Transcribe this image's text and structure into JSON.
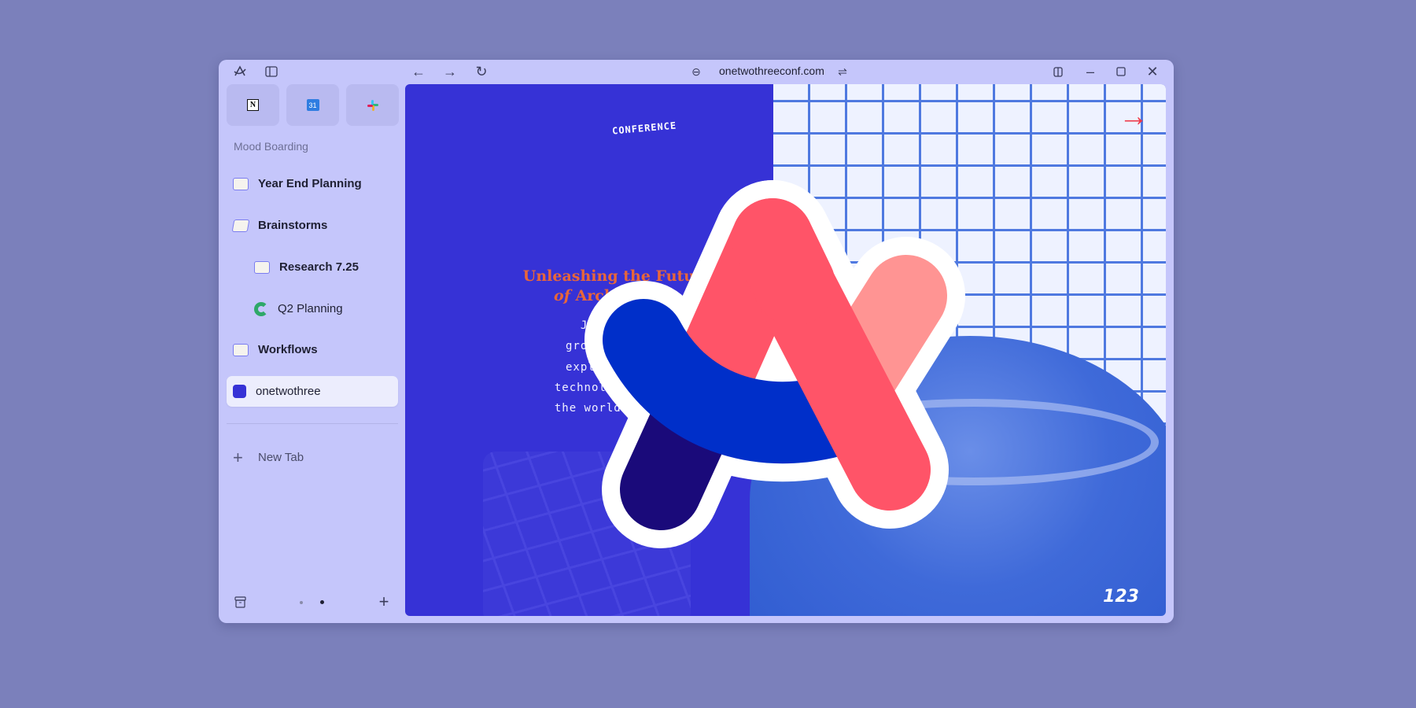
{
  "toolbar": {
    "url": "onetwothreeconf.com",
    "icons": [
      "arc-logo-icon",
      "sidebar-toggle-icon",
      "back-arrow-icon",
      "forward-arrow-icon",
      "reload-icon",
      "link-icon",
      "site-controls-icon",
      "split-view-icon",
      "minimize-icon",
      "maximize-icon",
      "close-icon"
    ]
  },
  "pinned": [
    {
      "name": "Notion",
      "glyph": "N"
    },
    {
      "name": "Google Calendar",
      "glyph": "31"
    },
    {
      "name": "Slack",
      "glyph": "#"
    }
  ],
  "sidebar": {
    "section": "Mood Boarding",
    "items": [
      {
        "label": "Year End Planning",
        "icon": "folder"
      },
      {
        "label": "Brainstorms",
        "icon": "folder-open"
      },
      {
        "label": "Research 7.25",
        "icon": "folder"
      },
      {
        "label": "Q2 Planning",
        "icon": "coda"
      },
      {
        "label": "Workflows",
        "icon": "folder"
      },
      {
        "label": "onetwothree",
        "icon": "favicon",
        "active": true
      }
    ],
    "new_tab": "New Tab"
  },
  "page": {
    "kicker": "CONFERENCE",
    "heading_line1": "Unleashing the Future",
    "heading_italic": "of",
    "heading_line2": "Architecture",
    "body": [
      "Join us in",
      "groundbreaking",
      "explores the l",
      "technologies, and",
      "the world of arch"
    ],
    "logo_mark": "123",
    "accent": "#e8663a",
    "panel_color": "#3632d6"
  },
  "colors": {
    "arc_red": "#ff5468",
    "arc_pink": "#ff9493",
    "arc_blue": "#002fc9",
    "arc_navy": "#1a0a7a"
  }
}
